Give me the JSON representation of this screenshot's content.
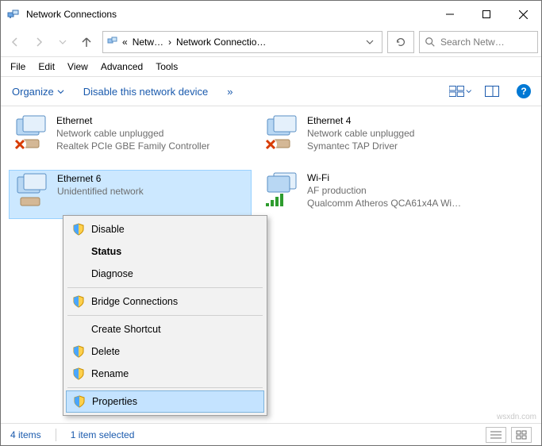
{
  "window": {
    "title": "Network Connections"
  },
  "nav": {
    "crumb1": "Netw…",
    "crumb2": "Network Connectio…",
    "search_placeholder": "Search Netw…"
  },
  "menu": {
    "file": "File",
    "edit": "Edit",
    "view": "View",
    "advanced": "Advanced",
    "tools": "Tools"
  },
  "cmd": {
    "organize": "Organize",
    "disable": "Disable this network device",
    "more": "»"
  },
  "adapters": [
    {
      "name": "Ethernet",
      "status": "Network cable unplugged",
      "driver": "Realtek PCIe GBE Family Controller",
      "state": "unplugged",
      "kind": "wired"
    },
    {
      "name": "Ethernet 4",
      "status": "Network cable unplugged",
      "driver": "Symantec TAP Driver",
      "state": "unplugged",
      "kind": "wired"
    },
    {
      "name": "Ethernet 6",
      "status": "Unidentified network",
      "driver": "",
      "state": "connected",
      "kind": "wired"
    },
    {
      "name": "Wi-Fi",
      "status": "AF production",
      "driver": "Qualcomm Atheros QCA61x4A Wi…",
      "state": "connected",
      "kind": "wifi"
    }
  ],
  "context_menu": {
    "disable": "Disable",
    "status": "Status",
    "diagnose": "Diagnose",
    "bridge": "Bridge Connections",
    "shortcut": "Create Shortcut",
    "delete": "Delete",
    "rename": "Rename",
    "properties": "Properties"
  },
  "statusbar": {
    "count": "4 items",
    "selected": "1 item selected"
  }
}
